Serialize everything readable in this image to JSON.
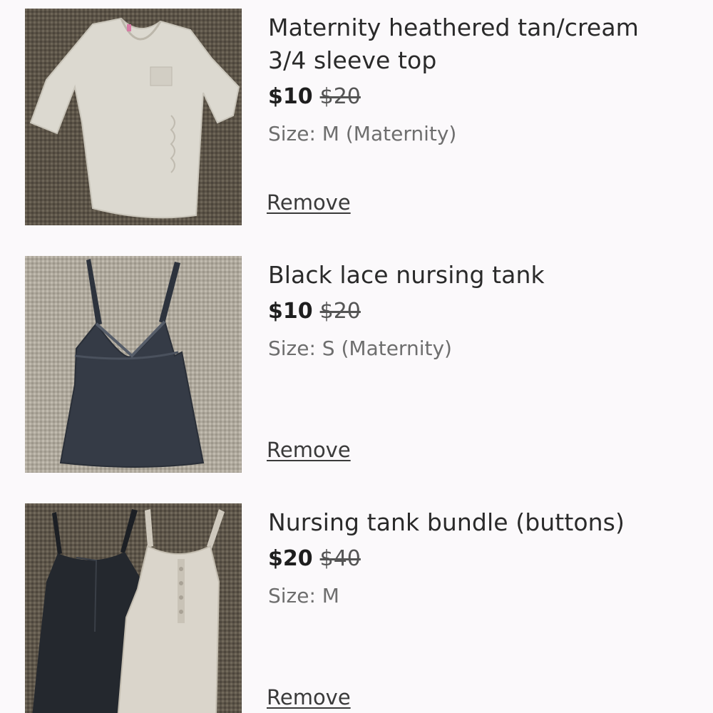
{
  "cart": {
    "items": [
      {
        "title_line1": "Maternity heathered tan/cream",
        "title_line2": "3/4 sleeve top",
        "price": "$10",
        "original_price": "$20",
        "size": "Size: M (Maternity)",
        "remove_label": "Remove"
      },
      {
        "title_line1": "Black lace nursing tank",
        "title_line2": "",
        "price": "$10",
        "original_price": "$20",
        "size": "Size: S (Maternity)",
        "remove_label": "Remove"
      },
      {
        "title_line1": "Nursing tank bundle (buttons)",
        "title_line2": "",
        "price": "$20",
        "original_price": "$40",
        "size": "Size: M",
        "remove_label": "Remove"
      }
    ]
  }
}
